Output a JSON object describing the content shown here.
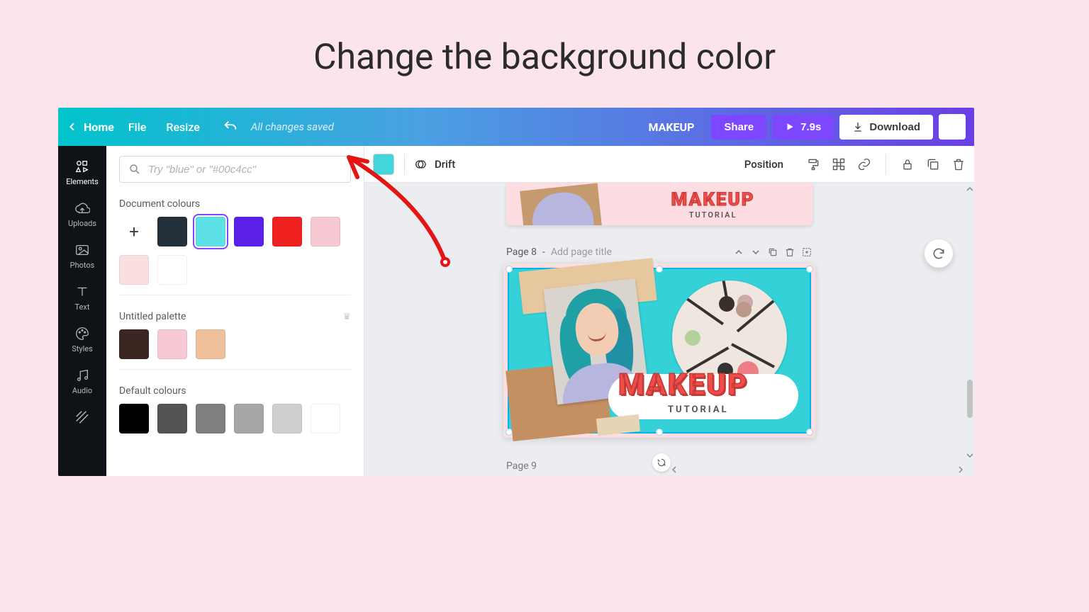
{
  "slide": {
    "title": "Change the background color"
  },
  "topbar": {
    "home": "Home",
    "file": "File",
    "resize": "Resize",
    "status": "All changes saved",
    "docname": "MAKEUP",
    "share": "Share",
    "duration": "7.9s",
    "download": "Download"
  },
  "rail": {
    "elements": "Elements",
    "uploads": "Uploads",
    "photos": "Photos",
    "text": "Text",
    "styles": "Styles",
    "audio": "Audio"
  },
  "panel": {
    "search_placeholder": "Try \"blue\" or \"#00c4cc\"",
    "section_document": "Document colours",
    "section_palette": "Untitled palette",
    "section_default": "Default colours",
    "doc_colors": [
      "#24303a",
      "#5de0e6",
      "#5b21e8",
      "#ef2020",
      "#f6c8d2",
      "#fadfe1",
      "#ffffff"
    ],
    "selected_doc_color": "#5de0e6",
    "palette_colors": [
      "#3b2621",
      "#f7c9d5",
      "#eec09c"
    ],
    "default_colors": [
      "#000000",
      "#545454",
      "#808080",
      "#a6a6a6",
      "#cfcfcf",
      "#ffffff"
    ]
  },
  "contextbar": {
    "bg_color": "#41d6db",
    "animation": "Drift",
    "position": "Position"
  },
  "canvas": {
    "page_label": "Page 8",
    "page_label_sep": " - ",
    "page_title_placeholder": "Add page title",
    "next_page_label": "Page 9",
    "artwork": {
      "headline": "MAKEUP",
      "subhead": "TUTORIAL"
    }
  }
}
